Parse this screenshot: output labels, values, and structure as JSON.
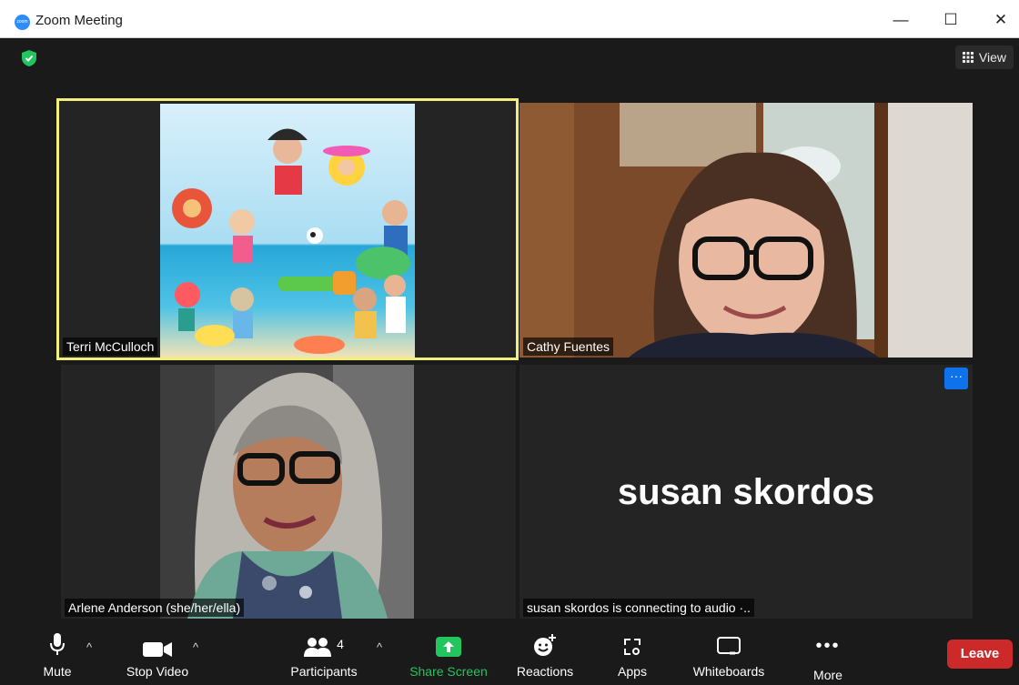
{
  "window": {
    "title": "Zoom Meeting",
    "minimize": "—",
    "maximize": "☐",
    "close": "✕",
    "logo_text": "zoom"
  },
  "header": {
    "view_label": "View"
  },
  "participants": [
    {
      "name": "Terri McCulloch"
    },
    {
      "name": "Cathy Fuentes"
    },
    {
      "name": "Arlene Anderson (she/her/ella)"
    },
    {
      "name": "susan skordos",
      "status": "susan skordos is connecting to audio ·.."
    }
  ],
  "toolbar": {
    "mute": "Mute",
    "stop_video": "Stop Video",
    "participants": "Participants",
    "participant_count": "4",
    "share_screen": "Share Screen",
    "reactions": "Reactions",
    "apps": "Apps",
    "whiteboards": "Whiteboards",
    "more": "More",
    "leave": "Leave"
  },
  "colors": {
    "accent_green": "#22c55e",
    "active_speaker": "#f0ee7c",
    "leave": "#cc2a2a",
    "more_button": "#0e72ed"
  }
}
